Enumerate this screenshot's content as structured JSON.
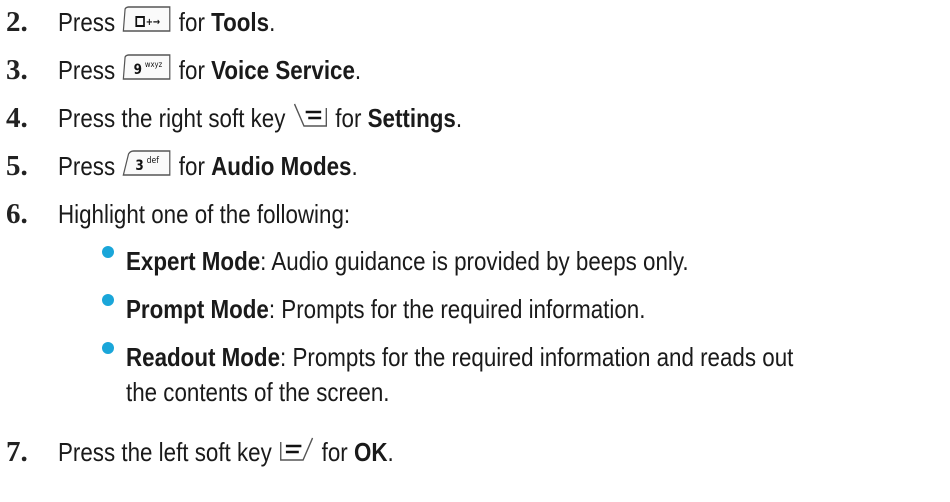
{
  "steps": [
    {
      "num": "2.",
      "pre": "Press",
      "key_icon": "tools-key-icon",
      "key_text": "0+→",
      "mid": "for",
      "bold": "Tools",
      "post": "."
    },
    {
      "num": "3.",
      "pre": "Press",
      "key_icon": "9-wxyz-key-icon",
      "key_text": "9 wxyz",
      "mid": "for",
      "bold": "Voice Service",
      "post": "."
    },
    {
      "num": "4.",
      "pre": "Press the right soft key",
      "key_icon": "right-soft-key-icon",
      "mid": "for",
      "bold": "Settings",
      "post": "."
    },
    {
      "num": "5.",
      "pre": "Press",
      "key_icon": "3-def-key-icon",
      "key_text": "3 def",
      "mid": "for",
      "bold": "Audio Modes",
      "post": "."
    },
    {
      "num": "6.",
      "text": "Highlight one of the following:"
    },
    {
      "num": "7.",
      "pre": "Press the left soft key",
      "key_icon": "left-soft-key-icon",
      "mid": "for",
      "bold": "OK",
      "post": "."
    }
  ],
  "options": [
    {
      "name": "Expert Mode",
      "desc": ": Audio guidance is provided by beeps only."
    },
    {
      "name": "Prompt Mode",
      "desc": ": Prompts for the required information."
    },
    {
      "name": "Readout Mode",
      "desc": ": Prompts for the required information and reads out",
      "desc_cont": "the contents of the screen."
    }
  ],
  "colors": {
    "bullet": "#1aa6d9",
    "text": "#1a1a1a"
  }
}
